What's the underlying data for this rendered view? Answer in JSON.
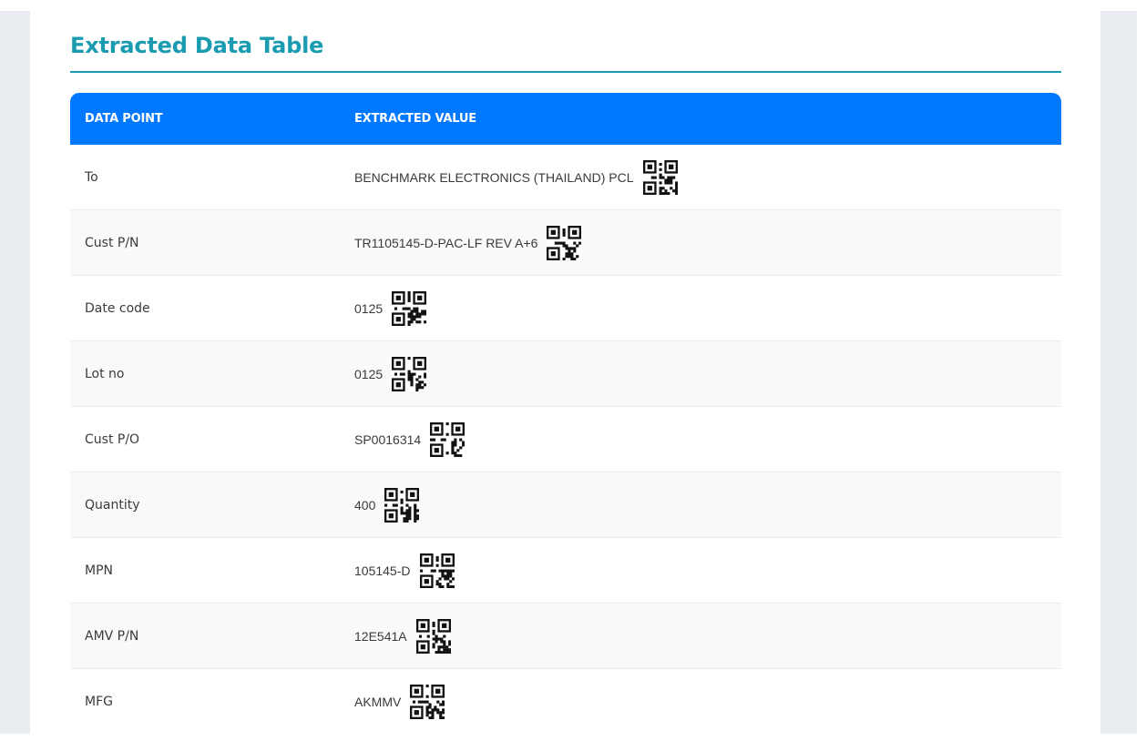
{
  "section": {
    "title": "Extracted Data Table"
  },
  "table": {
    "headers": {
      "data_point": "DATA POINT",
      "extracted_value": "EXTRACTED VALUE"
    },
    "rows": [
      {
        "label": "To",
        "value": "BENCHMARK ELECTRONICS (THAILAND) PCL",
        "icon": "qr-code-icon"
      },
      {
        "label": "Cust P/N",
        "value": "TR1105145-D-PAC-LF REV A+6",
        "icon": "qr-code-icon"
      },
      {
        "label": "Date code",
        "value": "0125",
        "icon": "qr-code-icon"
      },
      {
        "label": "Lot no",
        "value": "0125",
        "icon": "qr-code-icon"
      },
      {
        "label": "Cust P/O",
        "value": "SP0016314",
        "icon": "qr-code-icon"
      },
      {
        "label": "Quantity",
        "value": "400",
        "icon": "qr-code-icon"
      },
      {
        "label": "MPN",
        "value": "105145-D",
        "icon": "qr-code-icon"
      },
      {
        "label": "AMV P/N",
        "value": "12E541A",
        "icon": "qr-code-icon"
      },
      {
        "label": "MFG",
        "value": "AKMMV",
        "icon": "qr-code-icon"
      }
    ]
  },
  "colors": {
    "accent_teal": "#1a9bb0",
    "header_blue": "#0078ff",
    "page_bg": "#e9edf1",
    "row_alt": "#f8f9fa"
  }
}
